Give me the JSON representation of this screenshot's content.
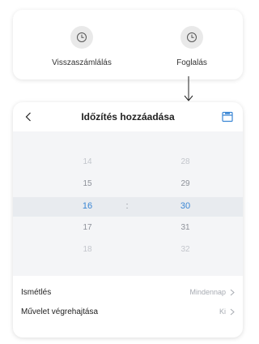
{
  "options": {
    "countdown_label": "Visszaszámlálás",
    "schedule_label": "Foglalás"
  },
  "header": {
    "title": "Időzítés hozzáadása"
  },
  "picker": {
    "hours": [
      "14",
      "15",
      "16",
      "17",
      "18"
    ],
    "minutes": [
      "28",
      "29",
      "30",
      "31",
      "32"
    ],
    "separator": ":",
    "selected_hour": "16",
    "selected_minute": "30"
  },
  "settings": {
    "repeat_label": "Ismétlés",
    "repeat_value": "Mindennap",
    "action_label": "Művelet végrehajtása",
    "action_value": "Ki"
  },
  "colors": {
    "accent": "#3a86d4",
    "selection_band": "#e8ebef",
    "picker_bg": "#f4f5f7"
  }
}
